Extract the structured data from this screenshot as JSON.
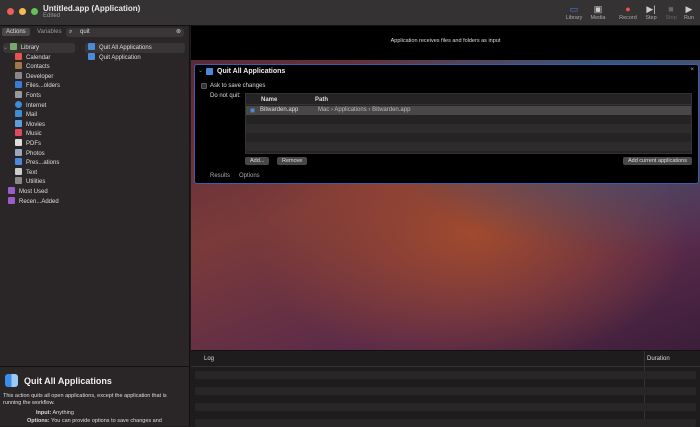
{
  "window": {
    "title": "Untitled.app (Application)",
    "subtitle": "Edited"
  },
  "toolbar": [
    {
      "label": "Library",
      "icon": "sidebar-icon"
    },
    {
      "label": "Media",
      "icon": "media-icon"
    },
    {
      "label": "Record",
      "icon": "record-icon"
    },
    {
      "label": "Step",
      "icon": "step-icon"
    },
    {
      "label": "Stop",
      "icon": "stop-icon"
    },
    {
      "label": "Run",
      "icon": "run-icon"
    }
  ],
  "left": {
    "tabs": [
      "Actions",
      "Variables"
    ],
    "search": "quit",
    "library": [
      "Library",
      "Calendar",
      "Contacts",
      "Developer",
      "Files...olders",
      "Fonts",
      "Internet",
      "Mail",
      "Movies",
      "Music",
      "PDFs",
      "Photos",
      "Pres...ations",
      "Text",
      "Utilities",
      "Most Used",
      "Recen...Added"
    ],
    "actions": [
      "Quit All Applications",
      "Quit Application"
    ]
  },
  "description": {
    "title": "Quit All Applications",
    "text": "This action quits all open applications, except the application that is running the workflow.",
    "input_label": "Input:",
    "input": "Anything",
    "options_label": "Options:",
    "options": "You can provide options to save changes and"
  },
  "workflow": {
    "input_banner": "Application receives files and folders as input",
    "action": {
      "title": "Quit All Applications",
      "ask_label": "Ask to save changes",
      "ask_checked": false,
      "do_not_quit_label": "Do not quit:",
      "columns": [
        "Name",
        "Path"
      ],
      "rows": [
        {
          "name": "Bitwarden.app",
          "path": [
            "Mac",
            "Applications",
            "Bitwarden.app"
          ]
        }
      ],
      "add": "Add...",
      "remove": "Remove",
      "add_current": "Add current applications",
      "tabs": [
        "Results",
        "Options"
      ]
    }
  },
  "log": {
    "columns": [
      "Log",
      "Duration"
    ]
  }
}
